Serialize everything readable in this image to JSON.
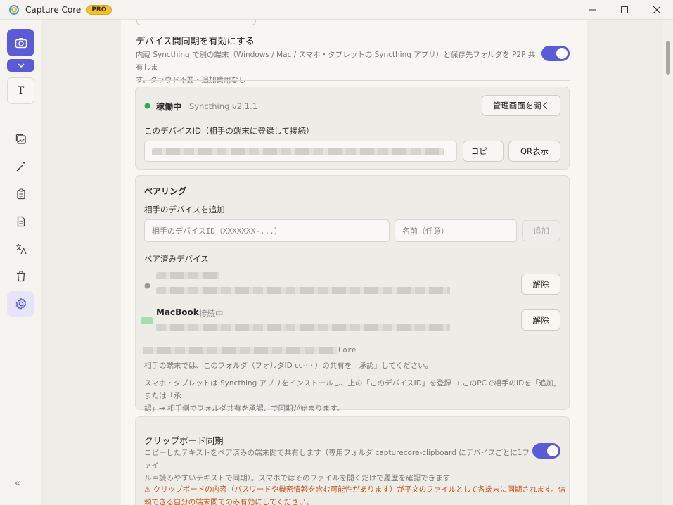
{
  "window": {
    "title": "Capture Core",
    "badge": "PRO"
  },
  "sidebar": {
    "text_tool": "T",
    "collapse": "«"
  },
  "device_sync": {
    "title": "デバイス間同期を有効にする",
    "desc_line1": "内蔵 Syncthing で別の端末（Windows / Mac / スマホ・タブレットの Syncthing アプリ）と保存先フォルダを P2P 共有しま",
    "desc_line2": "す。クラウド不要・追加費用なし",
    "enabled": true
  },
  "status_panel": {
    "status": "稼働中",
    "version": "Syncthing v2.1.1",
    "open_admin_label": "管理画面を開く",
    "device_id_label": "このデバイスID（相手の端末に登録して接続）",
    "copy_label": "コピー",
    "qr_label": "QR表示"
  },
  "pairing": {
    "title": "ペアリング",
    "add_label": "相手のデバイスを追加",
    "device_id_placeholder": "相手のデバイスID（XXXXXXX-...）",
    "name_placeholder": "名前（任意）",
    "add_button": "追加",
    "paired_label": "ペア済みデバイス",
    "devices": [
      {
        "name": "",
        "status": "",
        "unpair": "解除"
      },
      {
        "name": "MacBook",
        "status": "接続中",
        "unpair": "解除"
      }
    ],
    "folder_suffix": "Core",
    "note1": "相手の端末では、このフォルダ（フォルダID cc-···  ）の共有を「承認」してください。",
    "note2_line1": "スマホ・タブレットは Syncthing アプリをインストールし、上の「このデバイスID」を登録 → このPCで相手のIDを「追加」または「承",
    "note2_line2": "認」→ 相手側でフォルダ共有を承認、で同期が始まります。"
  },
  "clipboard_sync": {
    "title": "クリップボード同期",
    "desc_line1": "コピーしたテキストをペア済みの端末間で共有します（専用フォルダ capturecore-clipboard にデバイスごとに1ファイ",
    "desc_line2": "ル＝読みやすいテキストで同期）。スマホではそのファイルを開くだけで履歴を確認できます",
    "enabled": true,
    "warning_line1": "⚠ クリップボードの内容（パスワードや機密情報を含む可能性があります）が平文のファイルとして各端末に同期されます。信",
    "warning_line2": "頼できる自分の端末間でのみ有効にしてください。"
  },
  "colors": {
    "accent": "#5b5bd6",
    "status_green": "#22b14c",
    "warning": "#c8541a"
  }
}
